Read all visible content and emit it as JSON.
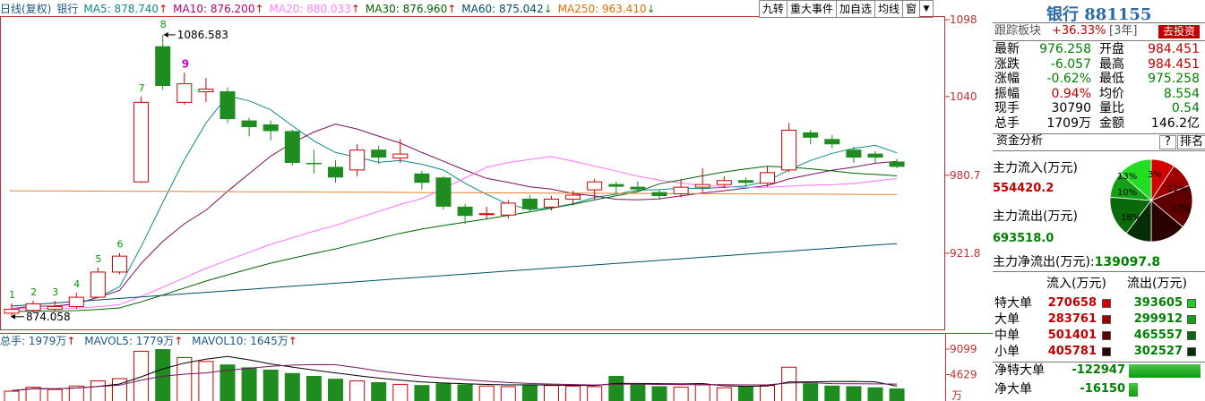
{
  "header": {
    "indicator": "日线(复权)",
    "name": "银行",
    "ma": [
      {
        "label": "MA5: 878.740",
        "arrow": "↑",
        "color": "#0a8a8a"
      },
      {
        "label": "MA10: 876.200",
        "arrow": "↑",
        "color": "#b0007a"
      },
      {
        "label": "MA20: 880.033",
        "arrow": "↑",
        "color": "#ff80ff"
      },
      {
        "label": "MA30: 876.960",
        "arrow": "↑",
        "color": "#006400"
      },
      {
        "label": "MA60: 875.042",
        "arrow": "↓",
        "color": "#004f6a"
      },
      {
        "label": "MA250: 963.410",
        "arrow": "↓",
        "color": "#e07000"
      }
    ],
    "toolbar": [
      "九转",
      "重大事件",
      "加自选",
      "均线",
      "窗"
    ]
  },
  "chart": {
    "price_axis": [
      "1098",
      "1040",
      "980.7",
      "921.8"
    ],
    "vol_axis": [
      "9099",
      "4629",
      "万"
    ],
    "high_label": "1086.583",
    "low_label": "874.058",
    "seq_labels": [
      "1",
      "2",
      "3",
      "4",
      "5",
      "6",
      "7",
      "8",
      "9"
    ],
    "up_color": "#d00000",
    "down_color": "#1e8c1e",
    "candles": [
      {
        "o": 877,
        "c": 880,
        "h": 884,
        "l": 874
      },
      {
        "o": 879,
        "c": 884,
        "h": 886,
        "l": 877
      },
      {
        "o": 880,
        "c": 882,
        "h": 886,
        "l": 878
      },
      {
        "o": 882,
        "c": 889,
        "h": 892,
        "l": 880
      },
      {
        "o": 889,
        "c": 908,
        "h": 911,
        "l": 888
      },
      {
        "o": 908,
        "c": 920,
        "h": 922,
        "l": 906
      },
      {
        "o": 976,
        "c": 1036,
        "h": 1040,
        "l": 975
      },
      {
        "o": 1078,
        "c": 1048,
        "h": 1086.583,
        "l": 1045
      },
      {
        "o": 1036,
        "c": 1050,
        "h": 1058,
        "l": 1034
      },
      {
        "o": 1044,
        "c": 1046,
        "h": 1054,
        "l": 1036
      },
      {
        "o": 1044,
        "c": 1023,
        "h": 1047,
        "l": 1020
      },
      {
        "o": 1022,
        "c": 1017,
        "h": 1024,
        "l": 1010
      },
      {
        "o": 1019,
        "c": 1014,
        "h": 1022,
        "l": 1007
      },
      {
        "o": 1014,
        "c": 990,
        "h": 1015,
        "l": 988
      },
      {
        "o": 990,
        "c": 989,
        "h": 1000,
        "l": 982
      },
      {
        "o": 987,
        "c": 979,
        "h": 992,
        "l": 975
      },
      {
        "o": 985,
        "c": 1000,
        "h": 1004,
        "l": 980
      },
      {
        "o": 1000,
        "c": 994,
        "h": 1003,
        "l": 989
      },
      {
        "o": 994,
        "c": 997,
        "h": 1008,
        "l": 990
      },
      {
        "o": 982,
        "c": 975,
        "h": 984,
        "l": 970
      },
      {
        "o": 979,
        "c": 957,
        "h": 980,
        "l": 955
      },
      {
        "o": 957,
        "c": 950,
        "h": 959,
        "l": 944
      },
      {
        "o": 952,
        "c": 952,
        "h": 957,
        "l": 948
      },
      {
        "o": 951,
        "c": 960,
        "h": 962,
        "l": 948
      },
      {
        "o": 963,
        "c": 955,
        "h": 966,
        "l": 953
      },
      {
        "o": 957,
        "c": 963,
        "h": 965,
        "l": 954
      },
      {
        "o": 963,
        "c": 966,
        "h": 969,
        "l": 958
      },
      {
        "o": 970,
        "c": 976,
        "h": 978,
        "l": 962
      },
      {
        "o": 974,
        "c": 972,
        "h": 976,
        "l": 966
      },
      {
        "o": 972,
        "c": 970,
        "h": 976,
        "l": 968
      },
      {
        "o": 968,
        "c": 965,
        "h": 970,
        "l": 962
      },
      {
        "o": 967,
        "c": 972,
        "h": 977,
        "l": 964
      },
      {
        "o": 972,
        "c": 974,
        "h": 986,
        "l": 968
      },
      {
        "o": 974,
        "c": 977,
        "h": 980,
        "l": 971
      },
      {
        "o": 977,
        "c": 975,
        "h": 979,
        "l": 972
      },
      {
        "o": 975,
        "c": 983,
        "h": 987,
        "l": 972
      },
      {
        "o": 985,
        "c": 1015,
        "h": 1020,
        "l": 983
      },
      {
        "o": 1013,
        "c": 1009,
        "h": 1015,
        "l": 1004
      },
      {
        "o": 1008,
        "c": 1004,
        "h": 1011,
        "l": 1001
      },
      {
        "o": 1000,
        "c": 994,
        "h": 1002,
        "l": 990
      },
      {
        "o": 997,
        "c": 994,
        "h": 999,
        "l": 990
      },
      {
        "o": 991,
        "c": 987,
        "h": 993,
        "l": 986
      }
    ],
    "volumes": [
      1800,
      2500,
      2100,
      2700,
      3600,
      4000,
      8800,
      9099,
      7700,
      7000,
      6400,
      5900,
      5500,
      4900,
      4400,
      3900,
      3600,
      3300,
      3000,
      2800,
      3100,
      2900,
      2700,
      2600,
      2900,
      2800,
      2700,
      2600,
      4400,
      2900,
      2600,
      2500,
      2900,
      2400,
      2500,
      2800,
      6000,
      3100,
      2700,
      2600,
      2400,
      2200
    ]
  },
  "vol_header": {
    "total": "总手: 1979万",
    "total_arrow": "↑",
    "mavol5": "MAVOL5: 1779万",
    "mavol5_arrow": "↑",
    "mavol10": "MAVOL10: 1645万",
    "mavol10_arrow": "↑"
  },
  "side": {
    "title": "银行 881155",
    "track_label": "跟踪板块",
    "track_value": "+36.33%",
    "track_period": "[3年]",
    "go_button": "去投资",
    "quote": [
      {
        "l1": "最新",
        "v1": "976.258",
        "c1": "green",
        "l2": "开盘",
        "v2": "984.451",
        "c2": "red"
      },
      {
        "l1": "涨跌",
        "v1": "-6.057",
        "c1": "green",
        "l2": "最高",
        "v2": "984.451",
        "c2": "red"
      },
      {
        "l1": "涨幅",
        "v1": "-0.62%",
        "c1": "green",
        "l2": "最低",
        "v2": "975.258",
        "c2": "green"
      },
      {
        "l1": "振幅",
        "v1": "0.94%",
        "c1": "red",
        "l2": "均价",
        "v2": "8.554",
        "c2": "green"
      },
      {
        "l1": "现手",
        "v1": "30790",
        "c1": "black",
        "l2": "量比",
        "v2": "0.54",
        "c2": "green"
      },
      {
        "l1": "总手",
        "v1": "1709万",
        "c1": "black",
        "l2": "金额",
        "v2": "146.2亿",
        "c2": "black"
      }
    ],
    "fund_title": "资金分析",
    "help": "?",
    "rank": "排名",
    "inflow_label": "主力流入(万元)",
    "inflow_value": "554420.2",
    "outflow_label": "主力流出(万元)",
    "outflow_value": "693518.0",
    "net_label": "主力净流出(万元):",
    "net_value": "139097.8",
    "pie_labels": [
      "13%",
      "3%",
      "11%",
      "17%",
      "18%",
      "10%"
    ],
    "pie_in": [
      270658,
      283761,
      501401,
      405781
    ],
    "pie_out": [
      393605,
      299912,
      465557,
      302527
    ],
    "pie_in_colors": [
      "#d40000",
      "#9a0000",
      "#5e0000",
      "#2a0000"
    ],
    "pie_out_colors": [
      "#22dd22",
      "#14a014",
      "#0a6a0a",
      "#052e05"
    ],
    "flow_header_in": "流入(万元)",
    "flow_header_out": "流出(万元)",
    "flows": [
      {
        "name": "特大单",
        "in": "270658",
        "out": "393605",
        "cin": "#d40000",
        "cout": "#22cc22"
      },
      {
        "name": "大单",
        "in": "283761",
        "out": "299912",
        "cin": "#9a0000",
        "cout": "#14a014"
      },
      {
        "name": "中单",
        "in": "501401",
        "out": "465557",
        "cin": "#5e0000",
        "cout": "#0a6a0a"
      },
      {
        "name": "小单",
        "in": "405781",
        "out": "302527",
        "cin": "#2a0000",
        "cout": "#052e05"
      }
    ],
    "net_rows": [
      {
        "name": "净特大单",
        "value": "-122947",
        "ratio": 1.0
      },
      {
        "name": "净大单",
        "value": "-16150",
        "ratio": 0.13
      }
    ]
  }
}
